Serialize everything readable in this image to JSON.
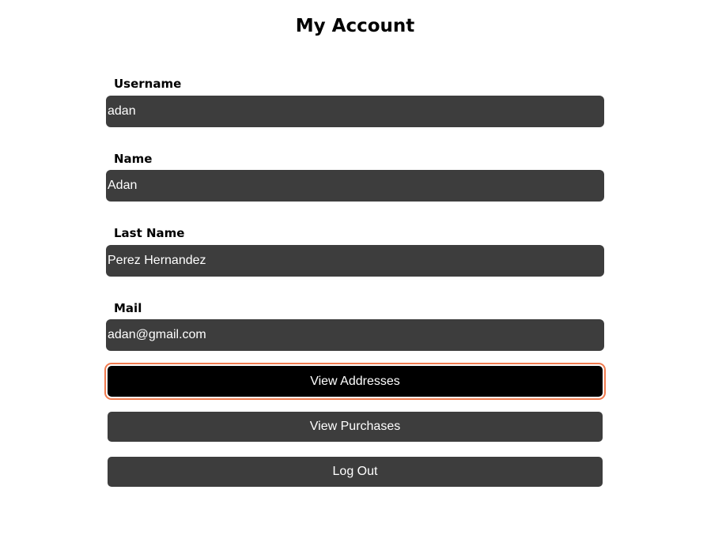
{
  "page": {
    "title": "My Account"
  },
  "form": {
    "fields": [
      {
        "label": "Username",
        "value": "adan"
      },
      {
        "label": "Name",
        "value": "Adan"
      },
      {
        "label": "Last Name",
        "value": "Perez Hernandez"
      },
      {
        "label": "Mail",
        "value": "adan@gmail.com"
      }
    ]
  },
  "actions": {
    "view_addresses": "View Addresses",
    "view_purchases": "View Purchases",
    "log_out": "Log Out"
  },
  "colors": {
    "field_background": "#3d3d3d",
    "focused_button_background": "#000000",
    "focus_ring": "#f07a4e",
    "text_on_dark": "#ffffff"
  }
}
